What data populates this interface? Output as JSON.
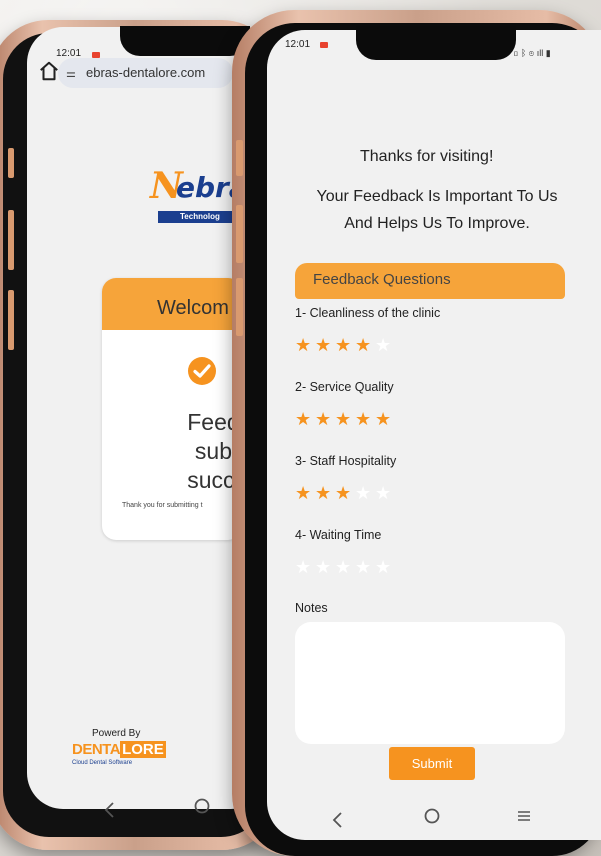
{
  "left_phone": {
    "status_time": "12:01",
    "url": "ebras-dentalore.com",
    "logo": {
      "letter": "N",
      "rest": "ebra",
      "tag": "Technolog"
    },
    "welcome_card": {
      "title": "Welcom",
      "message_lines": [
        "Feedbac",
        "submitt",
        "successf"
      ],
      "thanks_note": "Thank you for submitting t"
    },
    "powered_by": "Powerd By",
    "brand": {
      "part1": "DENTA",
      "part2": "LORE",
      "tagline": "Cloud Dental Software"
    }
  },
  "right_phone": {
    "status_time": "12:01",
    "status_icons": "▯ ᛒ ⊚ ıll ▮",
    "thanks_title": "Thanks for visiting!",
    "subtitle_lines": [
      "Your Feedback Is Important To Us",
      "And Helps Us To Improve."
    ],
    "section_header": "Feedback Questions",
    "questions": [
      {
        "label": "1- Cleanliness of the clinic",
        "rating": 4,
        "max": 5
      },
      {
        "label": "2- Service Quality",
        "rating": 5,
        "max": 5
      },
      {
        "label": "3- Staff Hospitality",
        "rating": 3,
        "max": 5
      },
      {
        "label": "4- Waiting Time",
        "rating": 0,
        "max": 5
      }
    ],
    "notes_label": "Notes",
    "notes_value": "",
    "submit_label": "Submit"
  },
  "big_letter": "F",
  "colors": {
    "accent": "#f6931f",
    "header": "#f6a43a",
    "brand_blue": "#1b3f8f"
  }
}
